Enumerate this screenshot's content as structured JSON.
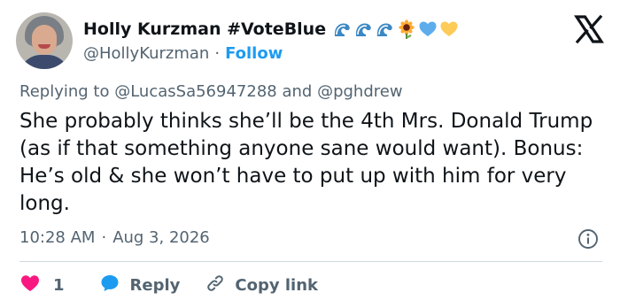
{
  "author": {
    "display_name": "Holly Kurzman #VoteBlue",
    "handle": "@HollyKurzman",
    "separator": "·",
    "follow_label": "Follow",
    "emoji_icons": [
      "wave-icon",
      "wave-icon",
      "wave-icon",
      "sunflower-icon",
      "blue-heart-icon",
      "yellow-heart-icon"
    ]
  },
  "reply_context": {
    "prefix": "Replying to",
    "mention_1": "@LucasSa56947288",
    "conjunction": "and",
    "mention_2": "@pghdrew"
  },
  "tweet": {
    "text": "She probably thinks she’ll be the 4th Mrs. Donald Trump (as if that something anyone sane would want). Bonus: He’s old & she won’t have to put up with him for very long.",
    "time": "10:28 AM",
    "separator": "·",
    "date": "Aug 3, 2026"
  },
  "actions": {
    "like_count": "1",
    "reply_label": "Reply",
    "copy_link_label": "Copy link"
  },
  "colors": {
    "accent": "#1d9bf0",
    "like": "#f91880",
    "muted": "#536471",
    "text": "#0f1419",
    "divider": "#cfd9de"
  }
}
